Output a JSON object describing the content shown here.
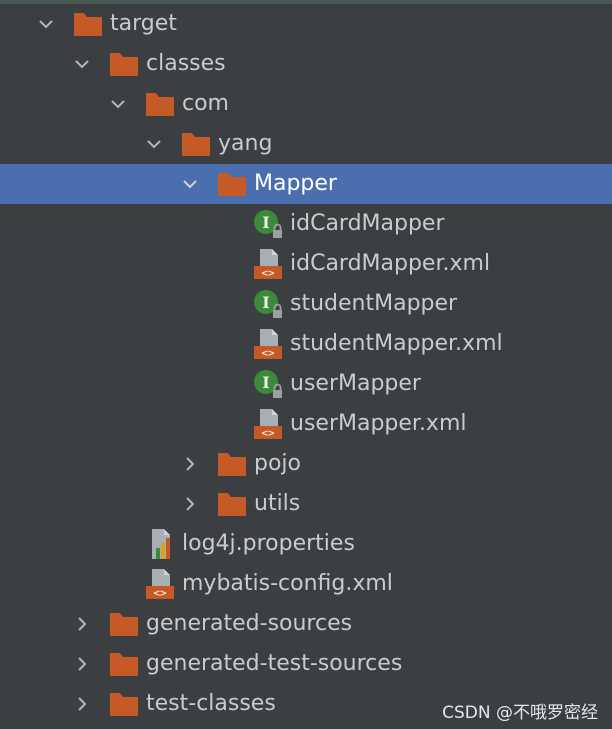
{
  "tree": {
    "target": "target",
    "classes": "classes",
    "com": "com",
    "yang": "yang",
    "mapper": "Mapper",
    "idCardMapper": "idCardMapper",
    "idCardMapperXml": "idCardMapper.xml",
    "studentMapper": "studentMapper",
    "studentMapperXml": "studentMapper.xml",
    "userMapper": "userMapper",
    "userMapperXml": "userMapper.xml",
    "pojo": "pojo",
    "utils": "utils",
    "log4j": "log4j.properties",
    "mybatisConfig": "mybatis-config.xml",
    "generatedSources": "generated-sources",
    "generatedTestSources": "generated-test-sources",
    "testClasses": "test-classes"
  },
  "selected_item": "Mapper",
  "watermark": "CSDN @不哦罗密经",
  "colors": {
    "background": "#3c3f41",
    "selection": "#4b6eaf",
    "folder": "#c65a27",
    "interface": "#3b8a3b",
    "text": "#c8ccce"
  }
}
